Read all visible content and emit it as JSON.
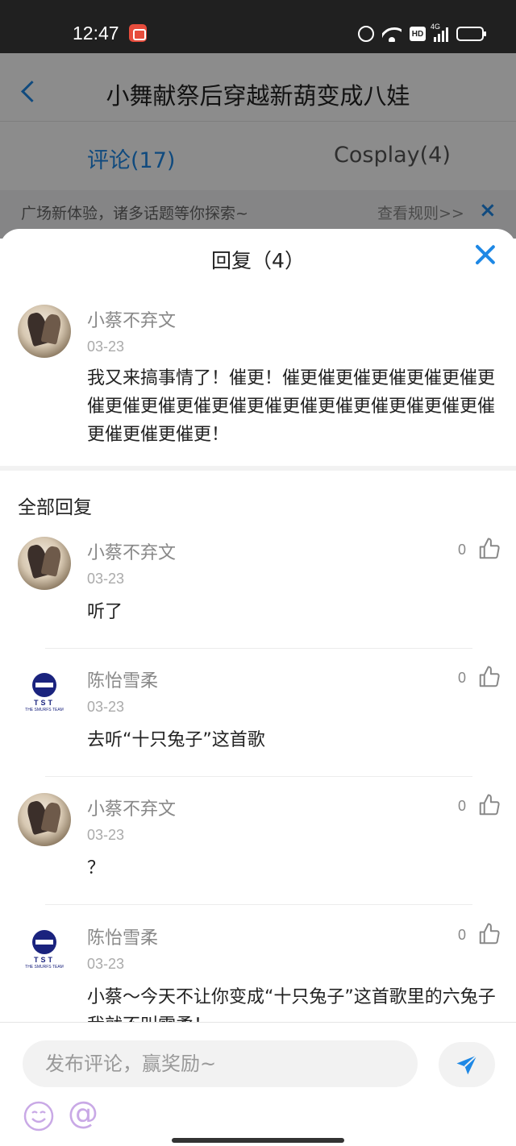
{
  "status_bar": {
    "time": "12:47",
    "hd_label": "HD",
    "signal_label": "4G"
  },
  "page": {
    "title": "小舞献祭后穿越新葫变成八娃",
    "tabs": [
      {
        "label": "评论(17)"
      },
      {
        "label": "Cosplay(4)"
      }
    ],
    "notice": {
      "text": "广场新体验，诸多话题等你探索~",
      "rules_link": "查看规则>>",
      "close": "×"
    }
  },
  "sheet": {
    "title": "回复（4）",
    "main_comment": {
      "user": "小蔡不弃文",
      "date": "03-23",
      "text": "我又来搞事情了！催更！催更催更催更催更催更催更催更催更催更催更催更催更催更催更催更催更催更催更催更催更催更！"
    },
    "all_replies_label": "全部回复",
    "replies": [
      {
        "user": "小蔡不弃文",
        "date": "03-23",
        "text": "听了",
        "likes": "0",
        "avatar": "art"
      },
      {
        "user": "陈怡雪柔",
        "date": "03-23",
        "text": "去听“十只兔子”这首歌",
        "likes": "0",
        "avatar": "tst"
      },
      {
        "user": "小蔡不弃文",
        "date": "03-23",
        "text": "？",
        "likes": "0",
        "avatar": "art"
      },
      {
        "user": "陈怡雪柔",
        "date": "03-23",
        "text": "小蔡～今天不让你变成“十只兔子”这首歌里的六兔子我就不叫雪柔！",
        "likes": "0",
        "avatar": "tst"
      }
    ],
    "tst_logo": {
      "letters": "TST",
      "sub": "THE SMURFS TEAM"
    }
  },
  "input": {
    "placeholder": "发布评论，赢奖励~",
    "at_symbol": "@"
  },
  "colors": {
    "accent": "#1e88e5",
    "emoji": "#c9a9e6"
  }
}
